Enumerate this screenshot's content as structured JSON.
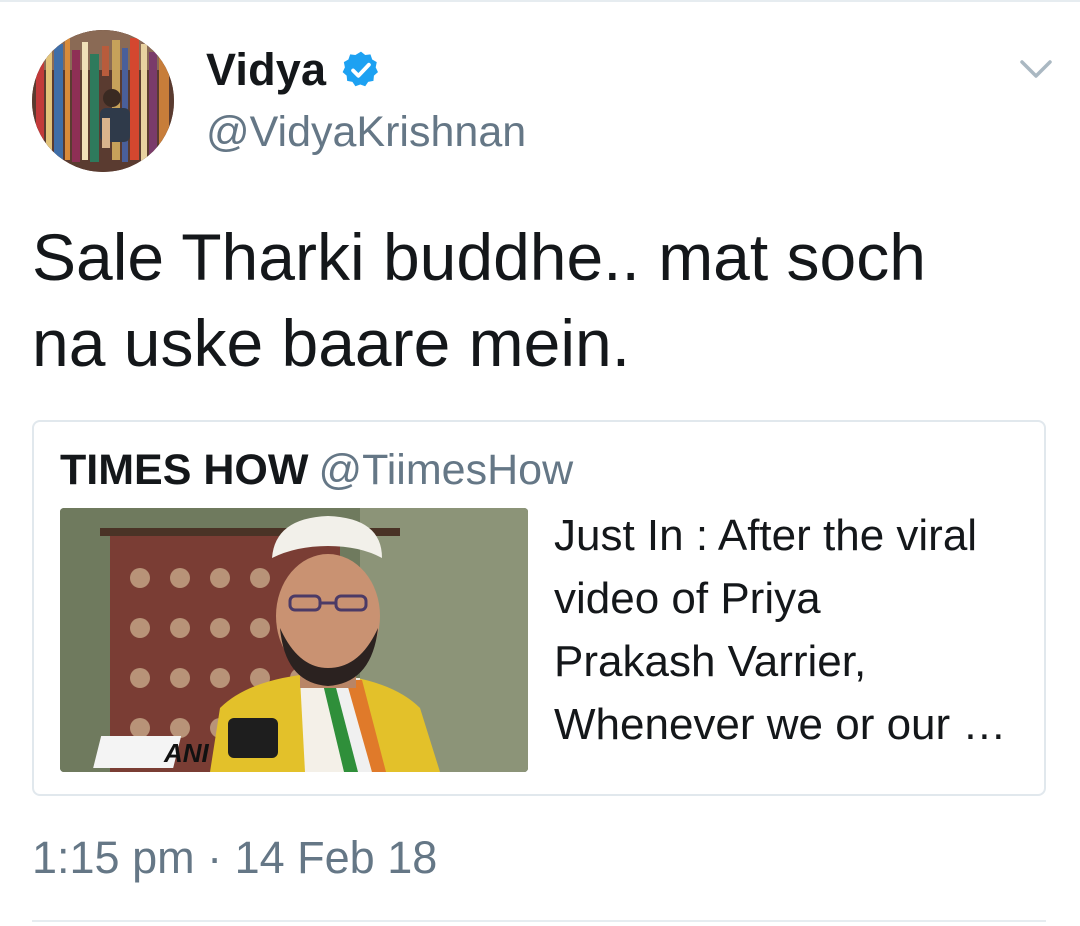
{
  "tweet": {
    "author": {
      "display_name": "Vidya",
      "handle": "@VidyaKrishnan",
      "verified": true,
      "avatar_icon": "bookstore-photo-avatar"
    },
    "menu_icon": "chevron-down-icon",
    "text_lines": [
      "Sale Tharki buddhe.. mat soch",
      "na uske baare mein."
    ],
    "timestamp": "1:15 pm · 14 Feb 18"
  },
  "quoted_tweet": {
    "display_name": "TIMES HOW",
    "handle": "@TiimesHow",
    "text_lines": [
      "Just In : After the viral",
      "video of Priya",
      "Prakash Varrier,",
      "Whenever we or our …"
    ],
    "media": {
      "description_icon": "news-photo-thumbnail",
      "watermark": "ANI"
    }
  },
  "colors": {
    "primary_text": "#14171a",
    "secondary_text": "#657786",
    "verified_blue": "#1da1f2",
    "border": "#e1e8ed"
  }
}
